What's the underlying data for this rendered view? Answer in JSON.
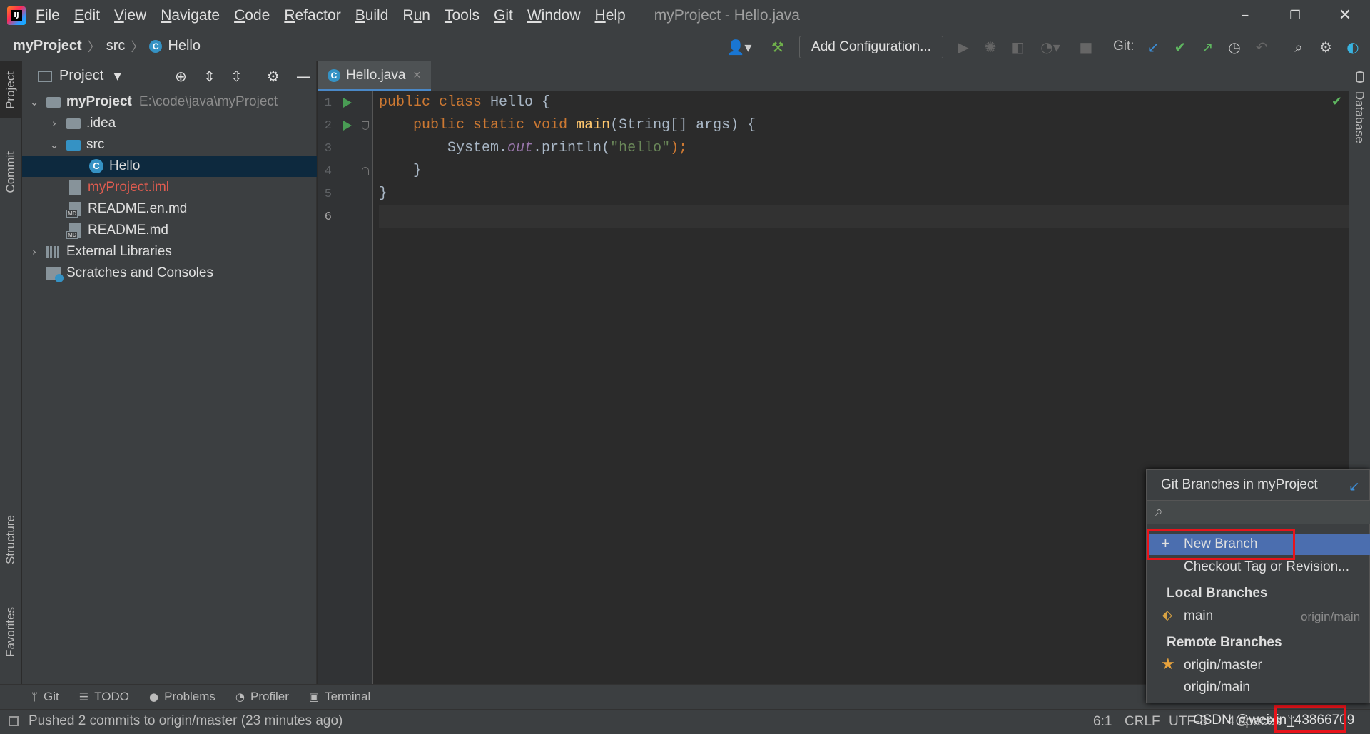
{
  "window": {
    "title": "myProject - Hello.java",
    "menu": [
      "File",
      "Edit",
      "View",
      "Navigate",
      "Code",
      "Refactor",
      "Build",
      "Run",
      "Tools",
      "Git",
      "Window",
      "Help"
    ],
    "menu_mnemonics": [
      "F",
      "E",
      "V",
      "N",
      "C",
      "R",
      "B",
      "u",
      "T",
      "G",
      "W",
      "H"
    ]
  },
  "navbar": {
    "breadcrumb": [
      "myProject",
      "src",
      "Hello"
    ],
    "add_configuration": "Add Configuration...",
    "git_label": "Git:"
  },
  "left_stripe": {
    "project": "Project",
    "commit": "Commit",
    "structure": "Structure",
    "favorites": "Favorites"
  },
  "right_stripe": {
    "database": "Database"
  },
  "project_panel": {
    "header": "Project",
    "tree": [
      {
        "label": "myProject",
        "path": "E:\\code\\java\\myProject"
      },
      {
        "label": ".idea"
      },
      {
        "label": "src"
      },
      {
        "label": "Hello"
      },
      {
        "label": "myProject.iml"
      },
      {
        "label": "README.en.md"
      },
      {
        "label": "README.md"
      },
      {
        "label": "External Libraries"
      },
      {
        "label": "Scratches and Consoles"
      }
    ]
  },
  "editor": {
    "tab": "Hello.java",
    "line_numbers": [
      "1",
      "2",
      "3",
      "4",
      "5",
      "6"
    ],
    "code": {
      "l1_kw1": "public",
      "l1_kw2": "class",
      "l1_rest": " Hello {",
      "l2_kw1": "public",
      "l2_kw2": "static",
      "l2_kw3": "void",
      "l2_fn": "main",
      "l2_rest": "(String[] args) {",
      "l3_a": "System.",
      "l3_fld": "out",
      "l3_b": ".println(",
      "l3_str": "\"hello\"",
      "l3_c": ");",
      "l4": "}",
      "l5": "}"
    }
  },
  "tool_tabs": [
    "Git",
    "TODO",
    "Problems",
    "Profiler",
    "Terminal"
  ],
  "status": {
    "message": "Pushed 2 commits to origin/master (23 minutes ago)",
    "position": "6:1",
    "line_sep": "CRLF",
    "encoding": "UTF-8",
    "indent": "4 spaces",
    "watermark": "CSDN @weixin_43866709"
  },
  "branch_popup": {
    "title": "Git Branches in myProject",
    "new_branch": "New Branch",
    "checkout": "Checkout Tag or Revision...",
    "local_header": "Local Branches",
    "local": [
      {
        "name": "main",
        "tracking": "origin/main"
      }
    ],
    "remote_header": "Remote Branches",
    "remote": [
      "origin/master",
      "origin/main"
    ]
  },
  "colors": {
    "accent": "#4b6eaf",
    "highlight_box": "#e8141b",
    "run_green": "#499c54"
  }
}
